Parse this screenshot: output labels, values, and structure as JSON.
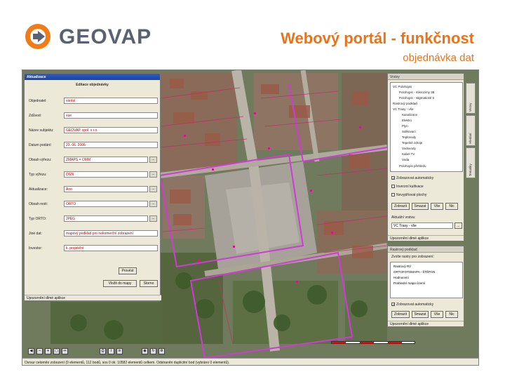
{
  "header": {
    "logo_text": "GEOVAP",
    "title": "Webový portál - funkčnost",
    "subtitle": "objednávka dat"
  },
  "dialog": {
    "title": "Aktualizace",
    "section": "Editace objednávky",
    "fields": [
      {
        "label": "Objednatel:",
        "value": "vontol",
        "dropdown": false
      },
      {
        "label": "Zdůvod:",
        "value": "vue",
        "dropdown": false
      },
      {
        "label": "Název subjektu:",
        "value": "GEOVAP, spol. s r.o.",
        "dropdown": false
      },
      {
        "label": "Datum podání:",
        "value": "23. 06. 2006",
        "dropdown": false
      },
      {
        "label": "Obsah výřezu:",
        "value": "ZMAPS = OMM",
        "dropdown": true
      },
      {
        "label": "Typ výřezu:",
        "value": "DGN",
        "dropdown": true
      },
      {
        "label": "Aktualizace:",
        "value": "Ano",
        "dropdown": true
      },
      {
        "label": "Obsah resti:",
        "value": "ORTO",
        "dropdown": true
      },
      {
        "label": "Typ ORTO:",
        "value": "JPEG",
        "dropdown": true
      },
      {
        "label": "Jiné dat:",
        "value": "mapový podklad pro nekomerční zobrazení",
        "dropdown": false
      },
      {
        "label": "Investor:",
        "value": "k. projekční",
        "dropdown": false
      }
    ],
    "buttons": {
      "save": "Provést",
      "export": "Vložit do mapy",
      "close": "Storno"
    },
    "footer": "Upozornění dlmé aplikce"
  },
  "right_panel": {
    "title": "Vrstvy",
    "tree": [
      "VC Polohopis",
      "Polohopis - mikrozimy 38",
      "Polohopis - stigmatické 5",
      "Rastrový podklad",
      "VC Trasy - vše",
      "Kanalizace",
      "Elektro",
      "Plyn",
      "Sdělovací",
      "Teplovody",
      "Tepelné zdroje",
      "Vodovody",
      "Kabel TV",
      "Voda",
      "Polohopis přehledu"
    ],
    "checks": [
      "Zobrazovat automaticky",
      "Inverzní kultivace",
      "Nevyplňovat plochy"
    ],
    "buttons": [
      "Zobrazit",
      "Smazat",
      "Vše",
      "Nic"
    ],
    "active_label": "Aktuální vrstva:",
    "active_value": "VC Trasy - vše",
    "footer": "Upozornění dlmé aplikce",
    "vtabs": [
      "Vrstvy",
      "Hledání",
      "Tematiky"
    ]
  },
  "right_panel2": {
    "title": "Rastrový podklad",
    "label": "Zvolte rastry pro zobrazení:",
    "items": [
      "Rastrový RV",
      "ORTOFOTOMAPA - ŠTĚPÁN",
      "Hodnocení",
      "Prahlední mapa území"
    ],
    "check": "Zobrazovat automaticky",
    "buttons": [
      "Zobrazit",
      "Smazat",
      "Vše",
      "Nic"
    ],
    "footer": "Upozornění dlmé aplikce"
  },
  "status": "Ovrsur celoměo zobození (0 elementů, 112 bodů, sos 0 ok: 10582 elementů celkem. Odstraněn duplicitní bod (vybráno 0 elementů)."
}
